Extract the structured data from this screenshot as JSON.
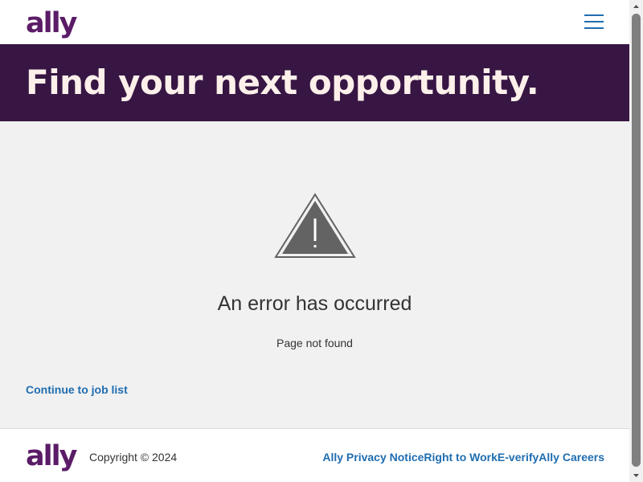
{
  "colors": {
    "brand_purple": "#5b1c67",
    "hero_bg": "#371644",
    "hero_text": "#fdf0ea",
    "main_bg": "#f1f1f1",
    "link_blue": "#1f6db0",
    "text_dark": "#333333"
  },
  "header": {
    "logo_text": "ally",
    "menu_icon": "hamburger-menu-icon"
  },
  "hero": {
    "title": "Find your next opportunity."
  },
  "main": {
    "warning_icon": "warning-triangle-icon",
    "error_title": "An error has occurred",
    "error_message": "Page not found",
    "continue_link": "Continue to job list"
  },
  "footer": {
    "logo_text": "ally",
    "copyright": "Copyright © 2024",
    "links": [
      {
        "label": "Ally Privacy Notice"
      },
      {
        "label": "Right to Work"
      },
      {
        "label": "E-verify"
      },
      {
        "label": "Ally Careers"
      }
    ]
  }
}
